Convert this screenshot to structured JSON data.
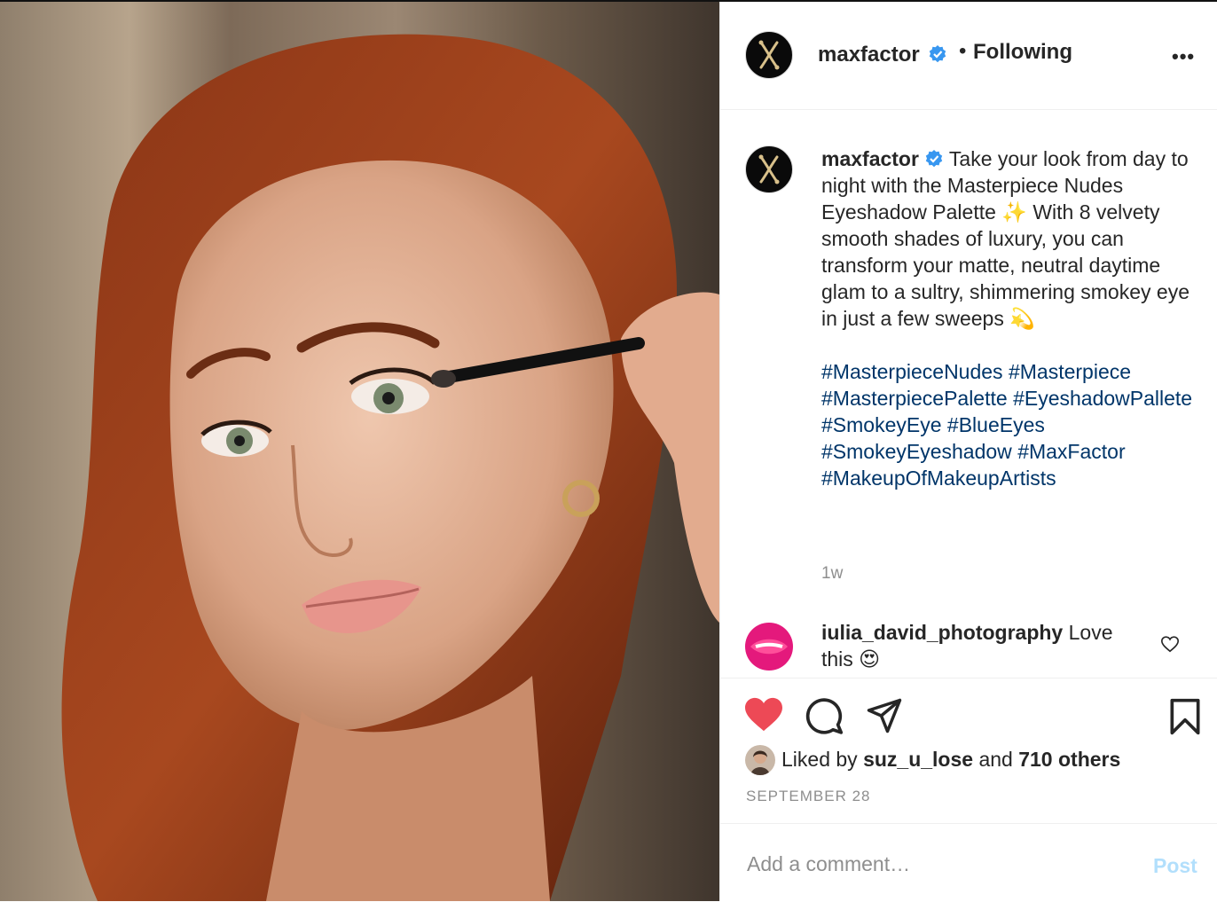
{
  "post": {
    "username": "maxfactor",
    "following_label": "Following",
    "more_label": "•••",
    "caption_text": "Take your look from day to night with the Masterpiece Nudes Eyeshadow Palette ✨ With 8 velvety smooth shades of luxury, you can transform your matte, neutral daytime glam to a sultry, shimmering smokey eye in just a few sweeps 💫",
    "hashtags": [
      "#MasterpieceNudes",
      "#Masterpiece",
      "#MasterpiecePalette",
      "#EyeshadowPallete",
      "#SmokeyEye",
      "#BlueEyes",
      "#SmokeyEyeshadow",
      "#MaxFactor",
      "#MakeupOfMakeupArtists"
    ],
    "age": "1w",
    "liked_by_prefix": "Liked by",
    "liked_by_user": "suz_u_lose",
    "liked_by_and": "and",
    "liked_by_others": "710 others",
    "date": "SEPTEMBER 28"
  },
  "comment": {
    "username": "iulia_david_photography",
    "text": "Love this 😍"
  },
  "comment_bar": {
    "placeholder": "Add a comment…",
    "post_label": "Post"
  },
  "colors": {
    "heart": "#ed4956",
    "link": "#003569",
    "verified": "#3897f0",
    "muted": "#8e8e8e",
    "post_disabled": "#b2dffc"
  }
}
